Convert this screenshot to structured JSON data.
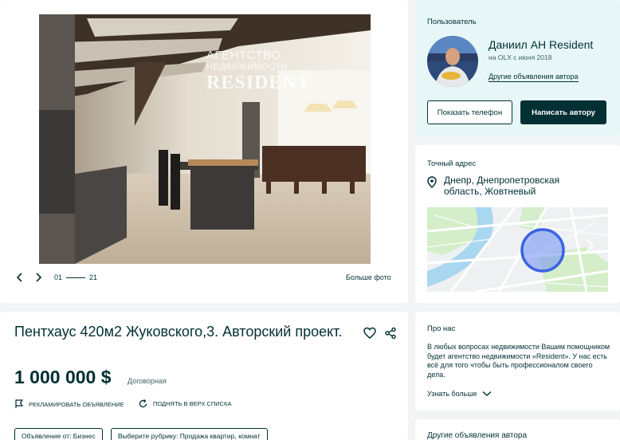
{
  "gallery": {
    "watermark": {
      "line1": "АГЕНТСТВО",
      "line2": "НЕДВИЖИМОСТИ",
      "line3": "RESIDENT"
    },
    "counter_current": "01",
    "counter_total": "21",
    "big_photo_label": "Больше фото"
  },
  "user": {
    "section_label": "Пользователь",
    "name": "Даниил АН Resident",
    "since": "на OLX с июня 2018",
    "other_ads_link": "Другие объявления автора",
    "show_phone": "Показать телефон",
    "write_author": "Написать автору"
  },
  "address": {
    "section_label": "Точный адрес",
    "text": "Днепр, Днепропетровская область, Жовтневый"
  },
  "listing": {
    "title": "Пентхаус 420м2 Жуковского,3. Авторский проект.",
    "price": "1 000 000 $",
    "negotiable": "Договорная",
    "promote": "РЕКЛАМИРОВАТЬ ОБЪЯВЛЕНИЕ",
    "raise": "ПОДНЯТЬ В ВЕРХ СПИСКА",
    "tags": [
      "Объявление от: Бизнес",
      "Выберите рубрику: Продажа квартир, комнат"
    ]
  },
  "about": {
    "section_label": "Про нас",
    "text": "В любых вопросах недвижимости Вашим помощником будет агентство недвижимости «Resident». У нас есть всё для того чтобы быть профессионалом своего дела.",
    "more": "Узнать больше"
  },
  "others": {
    "section_label": "Другие объявления автора"
  },
  "colors": {
    "brand_dark": "#002f34",
    "user_bg": "#e7f7f8",
    "page_bg": "#f2f4f5"
  }
}
